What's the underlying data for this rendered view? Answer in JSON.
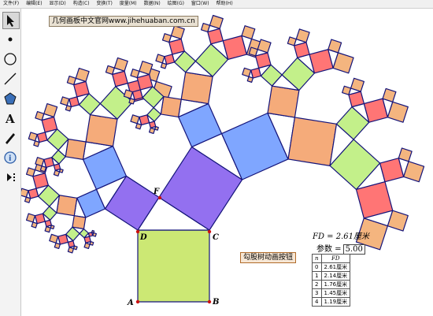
{
  "menu": [
    "文件(F)",
    "编辑(E)",
    "显示(D)",
    "构造(C)",
    "变换(T)",
    "度量(M)",
    "数据(N)",
    "绘图(G)",
    "窗口(W)",
    "帮助(H)"
  ],
  "tools": [
    "arrow-tool",
    "point-tool",
    "compass-tool",
    "line-tool",
    "polygon-tool",
    "text-tool",
    "marker-tool",
    "info-tool",
    "custom-tool"
  ],
  "website_tag": "几何画板中文官网www.jihehuaban.com.cn",
  "button_label": "勾股树动画按钮",
  "points": {
    "A": "A",
    "B": "B",
    "C": "C",
    "D": "D",
    "E": "E",
    "F": "F"
  },
  "measurement": {
    "label": "FD = 2.61厘米"
  },
  "parameter": {
    "label": "参数 =",
    "value": "5.00"
  },
  "table": {
    "headers": [
      "n",
      "FD"
    ],
    "rows": [
      [
        "0",
        "2.61厘米"
      ],
      [
        "1",
        "2.14厘米"
      ],
      [
        "2",
        "1.76厘米"
      ],
      [
        "3",
        "1.45厘米"
      ],
      [
        "4",
        "1.19厘米"
      ]
    ]
  },
  "colors": {
    "stroke": "#14147a",
    "point": "#cc1111"
  }
}
